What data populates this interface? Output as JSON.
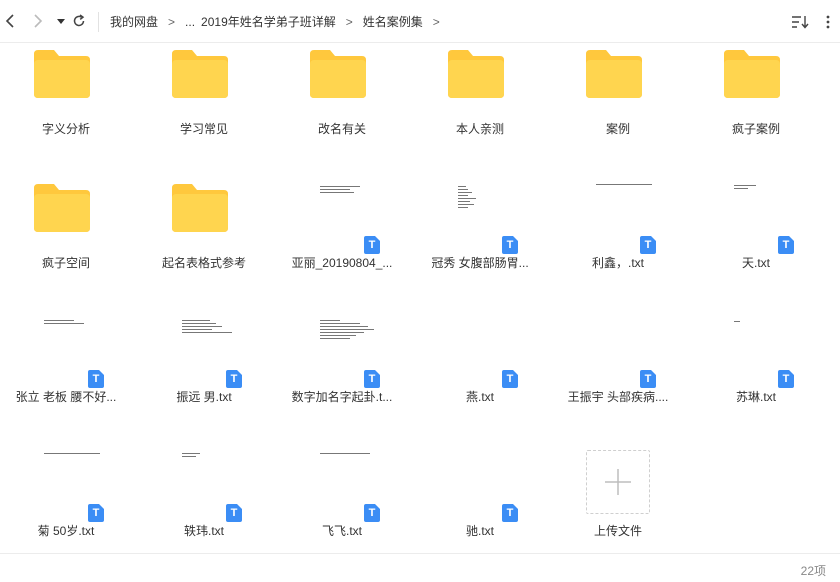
{
  "toolbar": {
    "icons": [
      "back-icon",
      "forward-icon",
      "history-dropdown-icon",
      "refresh-icon",
      "sort-icon",
      "more-icon"
    ]
  },
  "breadcrumb": {
    "root": "我的网盘",
    "ellipsis": "...",
    "level1": "2019年姓名学弟子班详解",
    "level2": "姓名案例集",
    "separator": ">"
  },
  "items": [
    {
      "type": "folder",
      "name": "字义分析"
    },
    {
      "type": "folder",
      "name": "学习常见"
    },
    {
      "type": "folder",
      "name": "改名有关"
    },
    {
      "type": "folder",
      "name": "本人亲测"
    },
    {
      "type": "folder",
      "name": "案例"
    },
    {
      "type": "folder",
      "name": "疯子案例"
    },
    {
      "type": "folder",
      "name": "疯子空间"
    },
    {
      "type": "folder",
      "name": "起名表格式参考"
    },
    {
      "type": "file",
      "name": "亚丽_20190804_..."
    },
    {
      "type": "file",
      "name": "冠秀  女腹部肠胃..."
    },
    {
      "type": "file",
      "name": "利鑫，.txt"
    },
    {
      "type": "file",
      "name": "天.txt"
    },
    {
      "type": "file",
      "name": "张立 老板 腰不好..."
    },
    {
      "type": "file",
      "name": "振远 男.txt"
    },
    {
      "type": "file",
      "name": "数字加名字起卦.t..."
    },
    {
      "type": "file",
      "name": "燕.txt"
    },
    {
      "type": "file",
      "name": "王振宇 头部疾病...."
    },
    {
      "type": "file",
      "name": "苏琳.txt"
    },
    {
      "type": "file",
      "name": "菊 50岁.txt"
    },
    {
      "type": "file",
      "name": "轶玮.txt"
    },
    {
      "type": "file",
      "name": "飞飞.txt"
    },
    {
      "type": "file",
      "name": "驰.txt"
    }
  ],
  "upload": {
    "label": "上传文件"
  },
  "status": {
    "count": "22项"
  },
  "colors": {
    "folder": "#FFD54F",
    "folder_tab": "#FFC83D",
    "badge": "#3B8DF5"
  }
}
